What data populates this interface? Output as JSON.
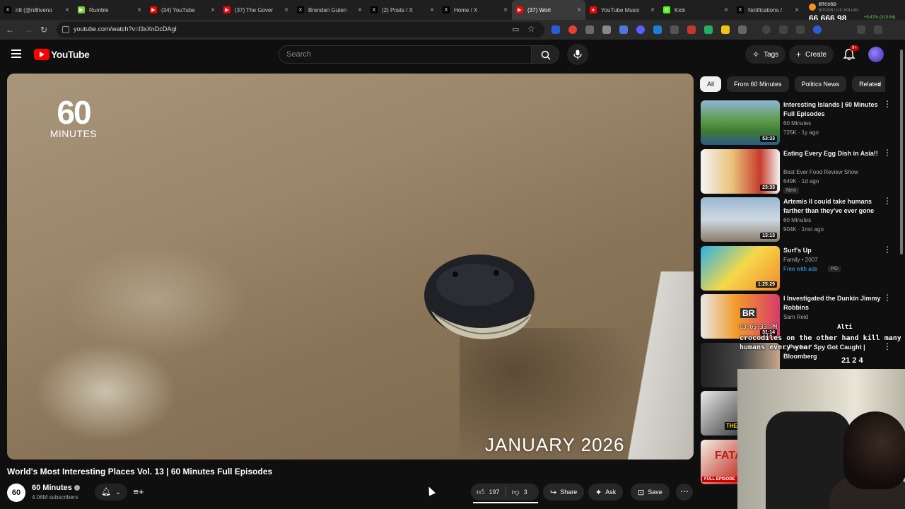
{
  "browser": {
    "tabs": [
      {
        "label": "n8 (@n8liveno",
        "fav_color": "#000000",
        "fav_glyph": "X",
        "active": false
      },
      {
        "label": "Rumble",
        "fav_color": "#85c742",
        "fav_glyph": "▶",
        "active": false
      },
      {
        "label": "(34) YouTube",
        "fav_color": "#ff0000",
        "fav_glyph": "▶",
        "active": false
      },
      {
        "label": "(37) The Gover",
        "fav_color": "#ff0000",
        "fav_glyph": "▶",
        "active": false
      },
      {
        "label": "Brendan Guten",
        "fav_color": "#000000",
        "fav_glyph": "X",
        "active": false
      },
      {
        "label": "(2) Posts / X",
        "fav_color": "#000000",
        "fav_glyph": "X",
        "active": false
      },
      {
        "label": "Home / X",
        "fav_color": "#000000",
        "fav_glyph": "X",
        "active": false
      },
      {
        "label": "(37) Worl",
        "fav_color": "#ff0000",
        "fav_glyph": "▶",
        "active": true
      },
      {
        "label": "YouTube Music",
        "fav_color": "#ff0000",
        "fav_glyph": "●",
        "active": false
      },
      {
        "label": "Kick",
        "fav_color": "#53fc18",
        "fav_glyph": "K",
        "active": false
      },
      {
        "label": "Notifications /",
        "fav_color": "#000000",
        "fav_glyph": "X",
        "active": false
      }
    ],
    "btc": {
      "ticker": "BTCUSD",
      "name": "BITCOIN / U.S. DOLLAR",
      "price": "66,666.98",
      "change": "+0.47% (313.64)"
    },
    "url": "youtube.com/watch?v=l3xXnDcDAgI"
  },
  "header": {
    "logo_text": "YouTube",
    "search_placeholder": "Search",
    "tags_label": "Tags",
    "create_label": "Create",
    "notif_badge": "9+"
  },
  "video": {
    "logo_number": "60",
    "logo_word": "MINUTES",
    "caption": "JANUARY 2026",
    "title": "World's Most Interesting Places Vol. 13 | 60 Minutes Full Episodes",
    "channel": "60 Minutes",
    "channel_avatar_text": "60",
    "subscribers": "4.06M subscribers",
    "likes": "197",
    "dislikes": "3",
    "share_label": "Share",
    "ask_label": "Ask",
    "save_label": "Save"
  },
  "chips": [
    "All",
    "From 60 Minutes",
    "Politics News",
    "Related"
  ],
  "recommendations": [
    {
      "title": "Interesting Islands | 60 Minutes Full Episodes",
      "channel": "60 Minutes",
      "meta": "725K · 1y ago",
      "duration": "53:33",
      "thumb": "islands"
    },
    {
      "title": "Eating Every Egg Dish in Asia!!",
      "channel": "Best Ever Food Review Show",
      "meta": "649K · 1d ago",
      "tag": "New",
      "duration": "23:33",
      "thumb": "egg"
    },
    {
      "title": "Artemis II could take humans farther than they've ever gone ...",
      "channel": "60 Minutes",
      "meta": "904K · 1mo ago",
      "duration": "13:13",
      "thumb": "rocket"
    },
    {
      "title": "Surf's Up",
      "channel": "Family • 2007",
      "free": "Free with ads",
      "tag": "PG",
      "duration": "1:25:29",
      "thumb": "surf"
    },
    {
      "title": "I Investigated the Dunkin Jimmy Robbins",
      "channel": "Sam Reid",
      "duration": "31:14",
      "thumb": "dunkin"
    },
    {
      "title": "...Perfect' Spy Got Caught | Bloomberg",
      "channel": "",
      "duration": "",
      "thumb": "spy"
    },
    {
      "title": "",
      "channel": "",
      "duration": "",
      "thumb": "they"
    },
    {
      "title": "",
      "channel": "",
      "duration": "",
      "thumb": "fatal"
    }
  ],
  "stream_overlay": {
    "timestamp": "03:05:33 PM",
    "user": "Alti",
    "message": "crocodiles on the other hand kill many humans every year",
    "counts": "21  2  4"
  },
  "thumb_labels": {
    "full_episode": "FULL EPISODE",
    "they": "THEY F",
    "fatal": "FATA",
    "br": "BR"
  }
}
